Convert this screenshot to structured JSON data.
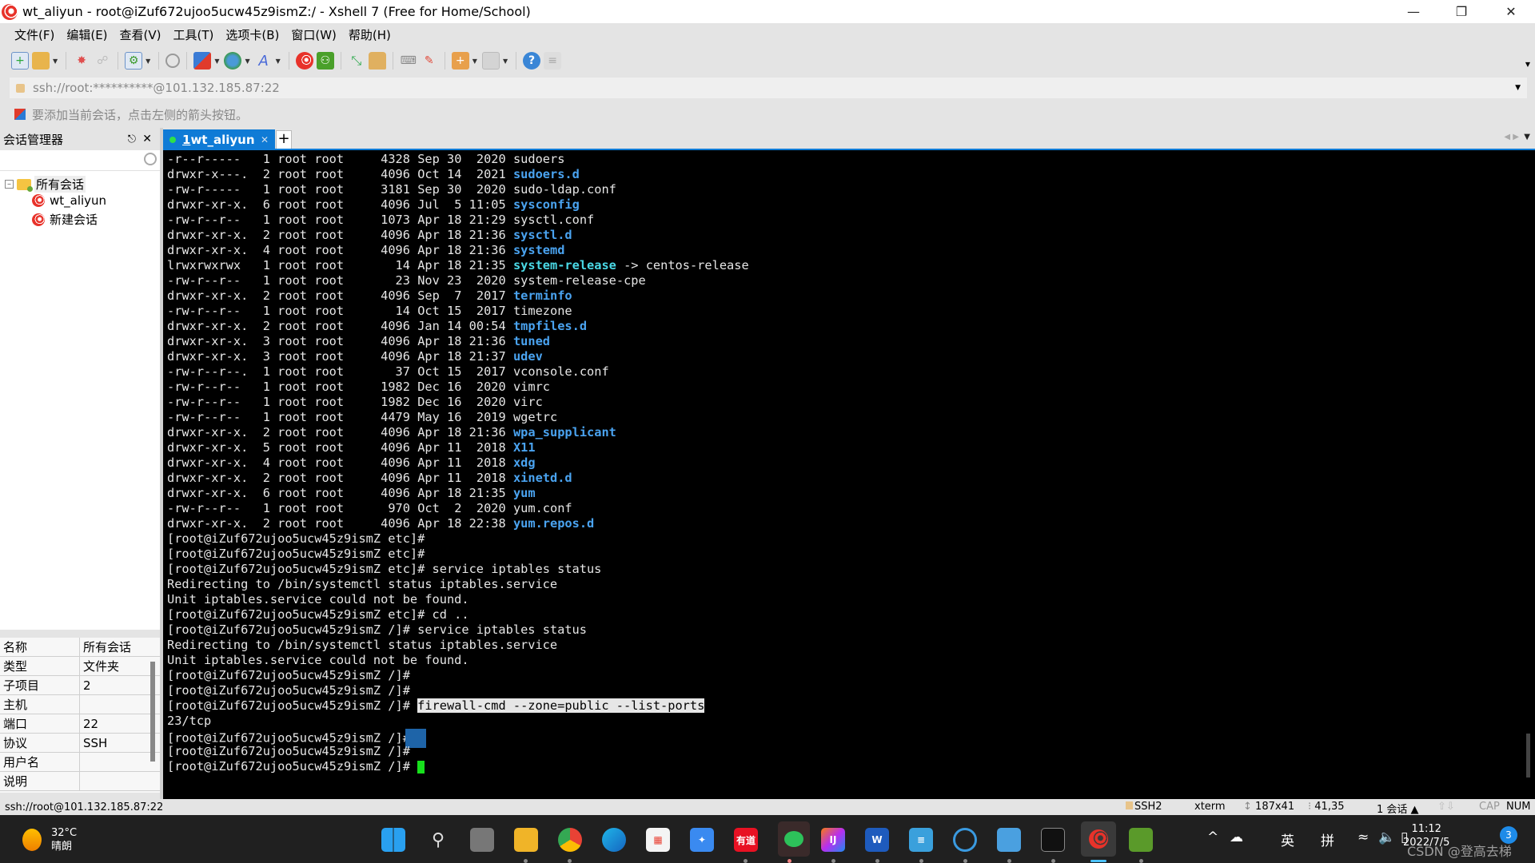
{
  "window": {
    "title": "wt_aliyun - root@iZuf672ujoo5ucw45z9ismZ:/ - Xshell 7 (Free for Home/School)",
    "controls": [
      "minimize",
      "restore",
      "close"
    ]
  },
  "menu": [
    "文件(F)",
    "编辑(E)",
    "查看(V)",
    "工具(T)",
    "选项卡(B)",
    "窗口(W)",
    "帮助(H)"
  ],
  "toolbar": {
    "icons": [
      "new-session-icon",
      "open-folder-icon",
      "reconnect-icon",
      "disconnect-icon",
      "properties-icon",
      "find-icon",
      "transfer-icon",
      "globe-icon",
      "font-icon",
      "xshell-icon",
      "xftp-icon",
      "fullscreen-icon",
      "lock-icon",
      "keyboard-icon",
      "highlight-icon",
      "new-folder-icon",
      "layout-icon",
      "help-icon",
      "chat-icon"
    ]
  },
  "address": {
    "value": "ssh://root:**********@101.132.185.87:22"
  },
  "hint": "要添加当前会话，点击左侧的箭头按钮。",
  "session_manager": {
    "title": "会话管理器",
    "search_placeholder": "",
    "tree": {
      "root": "所有会话",
      "children": [
        "wt_aliyun",
        "新建会话"
      ]
    },
    "properties": [
      {
        "key": "名称",
        "value": "所有会话"
      },
      {
        "key": "类型",
        "value": "文件夹"
      },
      {
        "key": "子项目",
        "value": "2"
      },
      {
        "key": "主机",
        "value": ""
      },
      {
        "key": "端口",
        "value": "22"
      },
      {
        "key": "协议",
        "value": "SSH"
      },
      {
        "key": "用户名",
        "value": ""
      },
      {
        "key": "说明",
        "value": ""
      }
    ]
  },
  "tabs": [
    {
      "number": "1",
      "label": " wt_aliyun",
      "active": true,
      "connected": true
    }
  ],
  "terminal": {
    "listing": [
      {
        "perm": "-r--r-----  ",
        "links": "1",
        "owner": "root",
        "group": "root",
        "size": "4328",
        "date": "Sep 30  2020",
        "name": "sudoers",
        "type": "file"
      },
      {
        "perm": "drwxr-x---. ",
        "links": "2",
        "owner": "root",
        "group": "root",
        "size": "4096",
        "date": "Oct 14  2021",
        "name": "sudoers.d",
        "type": "dir"
      },
      {
        "perm": "-rw-r-----  ",
        "links": "1",
        "owner": "root",
        "group": "root",
        "size": "3181",
        "date": "Sep 30  2020",
        "name": "sudo-ldap.conf",
        "type": "file"
      },
      {
        "perm": "drwxr-xr-x. ",
        "links": "6",
        "owner": "root",
        "group": "root",
        "size": "4096",
        "date": "Jul  5 11:05",
        "name": "sysconfig",
        "type": "dir"
      },
      {
        "perm": "-rw-r--r--  ",
        "links": "1",
        "owner": "root",
        "group": "root",
        "size": "1073",
        "date": "Apr 18 21:29",
        "name": "sysctl.conf",
        "type": "file"
      },
      {
        "perm": "drwxr-xr-x. ",
        "links": "2",
        "owner": "root",
        "group": "root",
        "size": "4096",
        "date": "Apr 18 21:36",
        "name": "sysctl.d",
        "type": "dir"
      },
      {
        "perm": "drwxr-xr-x. ",
        "links": "4",
        "owner": "root",
        "group": "root",
        "size": "4096",
        "date": "Apr 18 21:36",
        "name": "systemd",
        "type": "dir"
      },
      {
        "perm": "lrwxrwxrwx  ",
        "links": "1",
        "owner": "root",
        "group": "root",
        "size": "  14",
        "date": "Apr 18 21:35",
        "name": "system-release",
        "type": "link",
        "target": "centos-release"
      },
      {
        "perm": "-rw-r--r--  ",
        "links": "1",
        "owner": "root",
        "group": "root",
        "size": "  23",
        "date": "Nov 23  2020",
        "name": "system-release-cpe",
        "type": "file"
      },
      {
        "perm": "drwxr-xr-x. ",
        "links": "2",
        "owner": "root",
        "group": "root",
        "size": "4096",
        "date": "Sep  7  2017",
        "name": "terminfo",
        "type": "dir"
      },
      {
        "perm": "-rw-r--r--  ",
        "links": "1",
        "owner": "root",
        "group": "root",
        "size": "  14",
        "date": "Oct 15  2017",
        "name": "timezone",
        "type": "file"
      },
      {
        "perm": "drwxr-xr-x. ",
        "links": "2",
        "owner": "root",
        "group": "root",
        "size": "4096",
        "date": "Jan 14 00:54",
        "name": "tmpfiles.d",
        "type": "dir"
      },
      {
        "perm": "drwxr-xr-x. ",
        "links": "3",
        "owner": "root",
        "group": "root",
        "size": "4096",
        "date": "Apr 18 21:36",
        "name": "tuned",
        "type": "dir"
      },
      {
        "perm": "drwxr-xr-x. ",
        "links": "3",
        "owner": "root",
        "group": "root",
        "size": "4096",
        "date": "Apr 18 21:37",
        "name": "udev",
        "type": "dir"
      },
      {
        "perm": "-rw-r--r--. ",
        "links": "1",
        "owner": "root",
        "group": "root",
        "size": "  37",
        "date": "Oct 15  2017",
        "name": "vconsole.conf",
        "type": "file"
      },
      {
        "perm": "-rw-r--r--  ",
        "links": "1",
        "owner": "root",
        "group": "root",
        "size": "1982",
        "date": "Dec 16  2020",
        "name": "vimrc",
        "type": "file"
      },
      {
        "perm": "-rw-r--r--  ",
        "links": "1",
        "owner": "root",
        "group": "root",
        "size": "1982",
        "date": "Dec 16  2020",
        "name": "virc",
        "type": "file"
      },
      {
        "perm": "-rw-r--r--  ",
        "links": "1",
        "owner": "root",
        "group": "root",
        "size": "4479",
        "date": "May 16  2019",
        "name": "wgetrc",
        "type": "file"
      },
      {
        "perm": "drwxr-xr-x. ",
        "links": "2",
        "owner": "root",
        "group": "root",
        "size": "4096",
        "date": "Apr 18 21:36",
        "name": "wpa_supplicant",
        "type": "dir"
      },
      {
        "perm": "drwxr-xr-x. ",
        "links": "5",
        "owner": "root",
        "group": "root",
        "size": "4096",
        "date": "Apr 11  2018",
        "name": "X11",
        "type": "dir"
      },
      {
        "perm": "drwxr-xr-x. ",
        "links": "4",
        "owner": "root",
        "group": "root",
        "size": "4096",
        "date": "Apr 11  2018",
        "name": "xdg",
        "type": "dir"
      },
      {
        "perm": "drwxr-xr-x. ",
        "links": "2",
        "owner": "root",
        "group": "root",
        "size": "4096",
        "date": "Apr 11  2018",
        "name": "xinetd.d",
        "type": "dir"
      },
      {
        "perm": "drwxr-xr-x. ",
        "links": "6",
        "owner": "root",
        "group": "root",
        "size": "4096",
        "date": "Apr 18 21:35",
        "name": "yum",
        "type": "dir"
      },
      {
        "perm": "-rw-r--r--  ",
        "links": "1",
        "owner": "root",
        "group": "root",
        "size": " 970",
        "date": "Oct  2  2020",
        "name": "yum.conf",
        "type": "file"
      },
      {
        "perm": "drwxr-xr-x. ",
        "links": "2",
        "owner": "root",
        "group": "root",
        "size": "4096",
        "date": "Apr 18 22:38",
        "name": "yum.repos.d",
        "type": "dir"
      }
    ],
    "lines": [
      {
        "prompt": "[root@iZuf672ujoo5ucw45z9ismZ etc]#",
        "cmd": ""
      },
      {
        "prompt": "[root@iZuf672ujoo5ucw45z9ismZ etc]#",
        "cmd": ""
      },
      {
        "prompt": "[root@iZuf672ujoo5ucw45z9ismZ etc]#",
        "cmd": " service iptables status"
      },
      {
        "output": "Redirecting to /bin/systemctl status iptables.service"
      },
      {
        "output": "Unit iptables.service could not be found."
      },
      {
        "prompt": "[root@iZuf672ujoo5ucw45z9ismZ etc]#",
        "cmd": " cd .."
      },
      {
        "prompt": "[root@iZuf672ujoo5ucw45z9ismZ /]#",
        "cmd": " service iptables status"
      },
      {
        "output": "Redirecting to /bin/systemctl status iptables.service"
      },
      {
        "output": "Unit iptables.service could not be found."
      },
      {
        "prompt": "[root@iZuf672ujoo5ucw45z9ismZ /]#",
        "cmd": ""
      },
      {
        "prompt": "[root@iZuf672ujoo5ucw45z9ismZ /]#",
        "cmd": ""
      },
      {
        "prompt": "[root@iZuf672ujoo5ucw45z9ismZ /]#",
        "cmd": " ",
        "highlight": "firewall-cmd --zone=public --list-ports"
      },
      {
        "output": "23/tcp"
      },
      {
        "prompt": "[root@iZuf672ujoo5ucw45z9ismZ /]#",
        "cmd": "",
        "floating_icon": true
      },
      {
        "prompt": "[root@iZuf672ujoo5ucw45z9ismZ /]#",
        "cmd": ""
      },
      {
        "prompt": "[root@iZuf672ujoo5ucw45z9ismZ /]#",
        "cmd": " ",
        "cursor": true
      }
    ],
    "colors": {
      "dir": "#4aa3f0",
      "link": "#4ad9e6",
      "cursor": "#17e01c",
      "fg": "#e6e6e6"
    }
  },
  "statusbar": {
    "left": "ssh://root@101.132.185.87:22",
    "protocol": "SSH2",
    "term": "xterm",
    "size": "187x41",
    "cursor_pos": "41,35",
    "sessions": "1 会话",
    "cap": "CAP",
    "num": "NUM"
  },
  "taskbar": {
    "weather_temp": "32°C",
    "weather_desc": "晴朗",
    "apps": [
      "start",
      "search",
      "task-view",
      "file-explorer",
      "chrome",
      "edge",
      "store",
      "feishu",
      "youdao",
      "wechat",
      "intellij",
      "word",
      "notepad",
      "app-circles",
      "control-panel",
      "terminal",
      "xshell",
      "xftp"
    ],
    "tray": [
      "^",
      "☁",
      "英",
      "拼"
    ],
    "time": "11:12",
    "date": "2022/7/5",
    "notification_count": "3",
    "watermark": "CSDN @登高去梯"
  }
}
